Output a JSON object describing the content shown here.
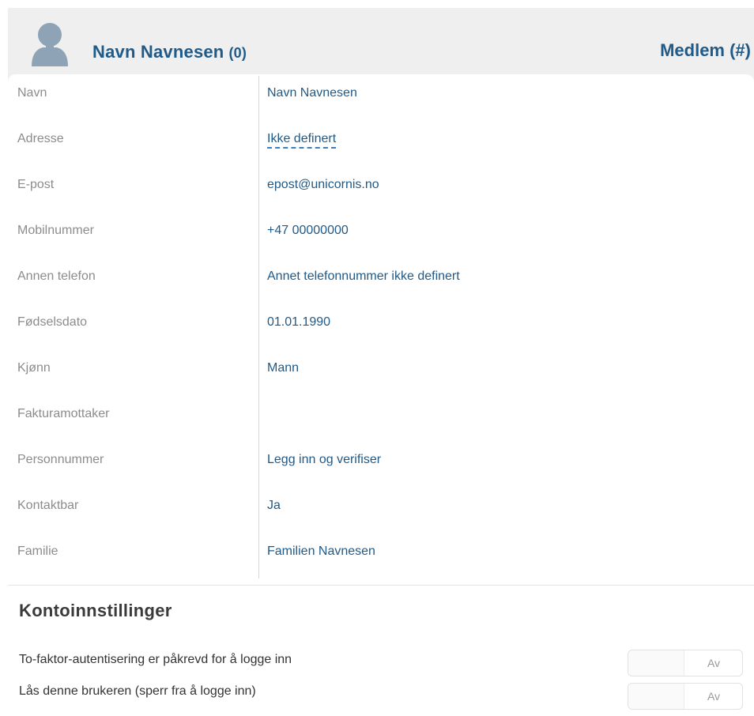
{
  "header": {
    "name": "Navn Navnesen",
    "count": "(0)",
    "role": "Medlem (#)"
  },
  "fields": [
    {
      "label": "Navn",
      "value": "Navn Navnesen"
    },
    {
      "label": "Adresse",
      "value": "Ikke definert"
    },
    {
      "label": "E-post",
      "value": "epost@unicornis.no"
    },
    {
      "label": "Mobilnummer",
      "value": "+47 00000000"
    },
    {
      "label": "Annen telefon",
      "value": "Annet telefonnummer ikke definert"
    },
    {
      "label": "Fødselsdato",
      "value": "01.01.1990"
    },
    {
      "label": "Kjønn",
      "value": "Mann"
    },
    {
      "label": "Fakturamottaker",
      "value": ""
    },
    {
      "label": "Personnummer",
      "value": "Legg inn og verifiser"
    },
    {
      "label": "Kontaktbar",
      "value": "Ja"
    },
    {
      "label": "Familie",
      "value": "Familien Navnesen"
    }
  ],
  "account_settings": {
    "title": "Kontoinnstillinger",
    "items": [
      {
        "label": "To-faktor-autentisering er påkrevd for å logge inn",
        "toggle": "Av"
      },
      {
        "label": "Lås denne brukeren (sperr fra å logge inn)",
        "toggle": "Av"
      }
    ]
  },
  "colors": {
    "accent": "#205a88",
    "label": "#8c8c8c",
    "page_bg": "#efefef"
  },
  "icons": {
    "avatar": "user-silhouette-icon"
  }
}
